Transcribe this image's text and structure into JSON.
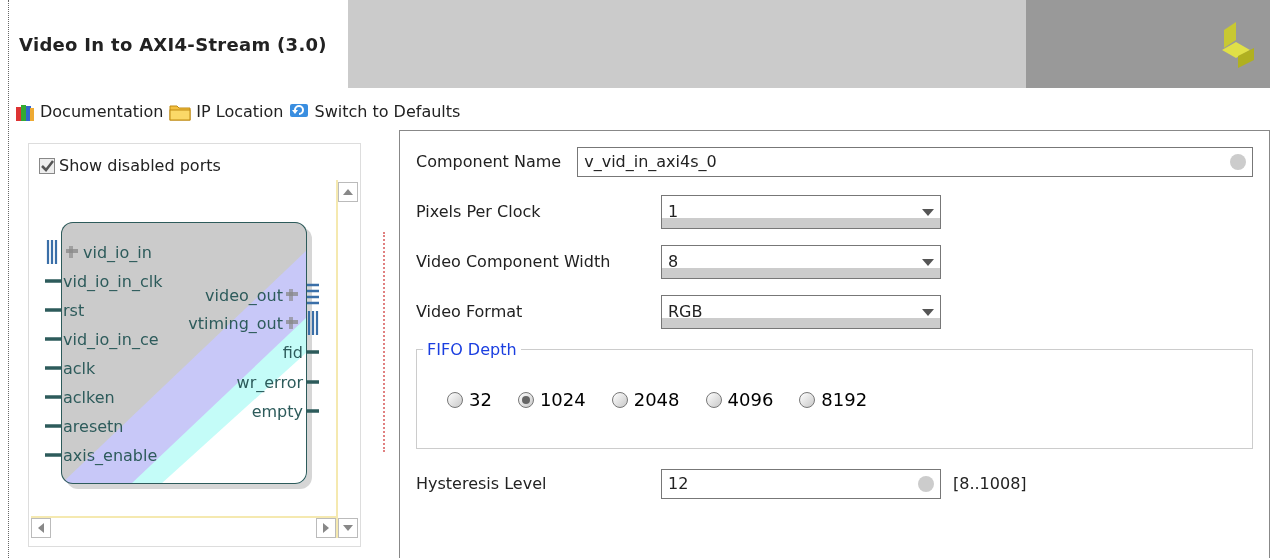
{
  "title": "Video In to AXI4-Stream (3.0)",
  "toolbar": [
    {
      "label": "Documentation",
      "kind": "book"
    },
    {
      "label": "IP Location",
      "kind": "folder"
    },
    {
      "label": "Switch to Defaults",
      "kind": "reset"
    }
  ],
  "show_disabled_ports": {
    "label": "Show disabled ports",
    "checked": true
  },
  "block": {
    "inputs": [
      {
        "name": "vid_io_in",
        "kind": "bus"
      },
      {
        "name": "vid_io_in_clk",
        "kind": "wire"
      },
      {
        "name": "rst",
        "kind": "wire"
      },
      {
        "name": "vid_io_in_ce",
        "kind": "wire"
      },
      {
        "name": "aclk",
        "kind": "wire"
      },
      {
        "name": "aclken",
        "kind": "wire"
      },
      {
        "name": "aresetn",
        "kind": "wire"
      },
      {
        "name": "axis_enable",
        "kind": "wire"
      }
    ],
    "outputs": [
      {
        "name": "video_out",
        "kind": "bus"
      },
      {
        "name": "vtiming_out",
        "kind": "bus"
      },
      {
        "name": "fid",
        "kind": "wire"
      },
      {
        "name": "wr_error",
        "kind": "wire"
      },
      {
        "name": "empty",
        "kind": "wire"
      }
    ]
  },
  "component_name": {
    "label": "Component Name",
    "value": "v_vid_in_axi4s_0"
  },
  "fields": [
    {
      "label": "Pixels Per Clock",
      "value": "1"
    },
    {
      "label": "Video Component Width",
      "value": "8"
    },
    {
      "label": "Video Format",
      "value": "RGB"
    }
  ],
  "fifo_depth": {
    "title": "FIFO Depth",
    "options": [
      {
        "label": "32",
        "selected": false
      },
      {
        "label": "1024",
        "selected": true
      },
      {
        "label": "2048",
        "selected": false
      },
      {
        "label": "4096",
        "selected": false
      },
      {
        "label": "8192",
        "selected": false
      }
    ]
  },
  "hysteresis": {
    "label": "Hysteresis Level",
    "value": "12",
    "range": "[8..1008]"
  }
}
